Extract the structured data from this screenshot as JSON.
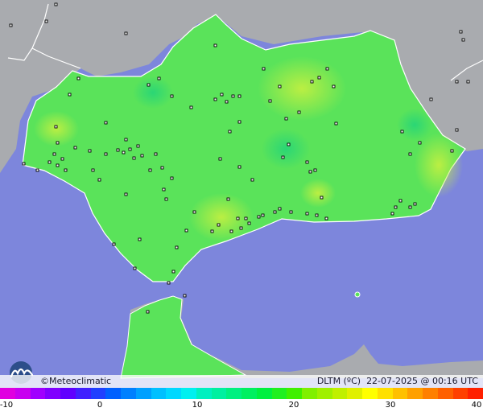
{
  "map": {
    "sea_color": "#7d86dc",
    "land_outside_color": "#a9abaf",
    "region_base_color": "#5ae35a"
  },
  "footer": {
    "brand": "Meteoclimatic",
    "copyright_symbol": "©",
    "variable": "DLTM (ºC)",
    "datetime": "22-07-2025 @ 00:16 UTC"
  },
  "legend": {
    "ticks": [
      "-10",
      "0",
      "10",
      "20",
      "30",
      "40"
    ],
    "colors": [
      "#e000e0",
      "#c800f0",
      "#a000ff",
      "#8000ff",
      "#6000ff",
      "#4020ff",
      "#2040ff",
      "#0060ff",
      "#0080ff",
      "#00a0ff",
      "#00c0ff",
      "#00d8ff",
      "#00f0f0",
      "#00f0c0",
      "#00f0a0",
      "#00f080",
      "#00f060",
      "#00f040",
      "#20f020",
      "#40f000",
      "#80f000",
      "#a0f000",
      "#c0f000",
      "#e0f000",
      "#ffff00",
      "#ffe000",
      "#ffc000",
      "#ffa000",
      "#ff8000",
      "#ff6000",
      "#ff4000",
      "#ff2000"
    ]
  }
}
